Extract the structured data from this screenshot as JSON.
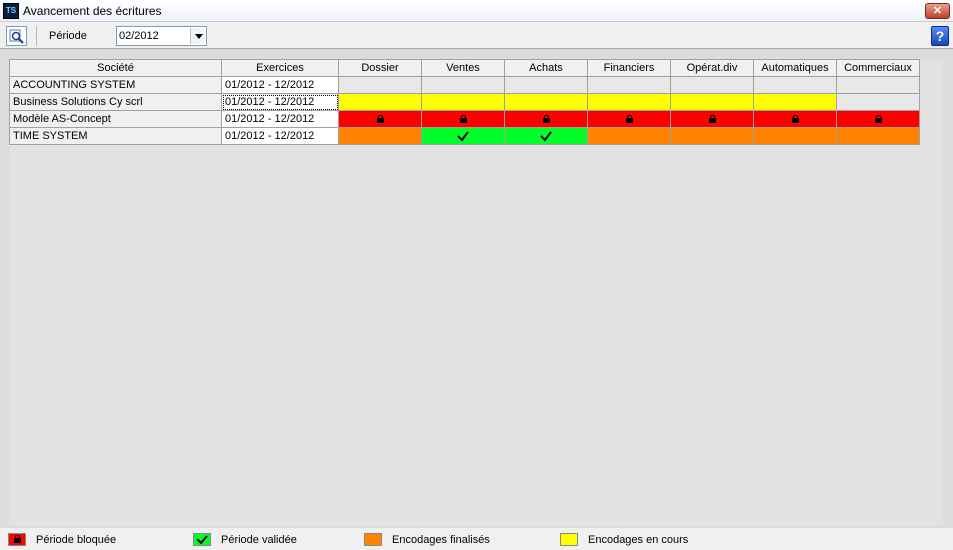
{
  "window": {
    "title": "Avancement des écritures",
    "app_icon": "TS",
    "close_label": "✕"
  },
  "toolbar": {
    "search_icon": "magnifier-icon",
    "periode_label": "Période",
    "periode_value": "02/2012",
    "help_label": "?"
  },
  "grid": {
    "columns": [
      "Société",
      "Exercices",
      "Dossier",
      "Ventes",
      "Achats",
      "Financiers",
      "Opérat.div",
      "Automatiques",
      "Commerciaux"
    ],
    "rows": [
      {
        "societe": "ACCOUNTING SYSTEM",
        "exercices": "01/2012 - 12/2012",
        "statuses": [
          "empty",
          "empty",
          "empty",
          "empty",
          "empty",
          "empty",
          "empty"
        ]
      },
      {
        "societe": "Business Solutions Cy scrl",
        "exercices": "01/2012 - 12/2012",
        "statuses": [
          "inprogress",
          "inprogress",
          "inprogress",
          "inprogress",
          "inprogress",
          "inprogress",
          "empty"
        ]
      },
      {
        "societe": "Modèle AS-Concept",
        "exercices": "01/2012 - 12/2012",
        "statuses": [
          "locked",
          "locked",
          "locked",
          "locked",
          "locked",
          "locked",
          "locked"
        ]
      },
      {
        "societe": "TIME SYSTEM",
        "exercices": "01/2012 - 12/2012",
        "statuses": [
          "finalized",
          "validated",
          "validated",
          "finalized",
          "finalized",
          "finalized",
          "finalized"
        ]
      }
    ]
  },
  "legend": {
    "locked": {
      "label": "Période bloquée",
      "color": "#ff0000",
      "icon": "lock-icon"
    },
    "validated": {
      "label": "Période validée",
      "color": "#00ff2a",
      "icon": "checkmark-icon"
    },
    "finalized": {
      "label": "Encodages finalisés",
      "color": "#ff8200"
    },
    "inprogress": {
      "label": "Encodages en cours",
      "color": "#ffff00"
    }
  }
}
